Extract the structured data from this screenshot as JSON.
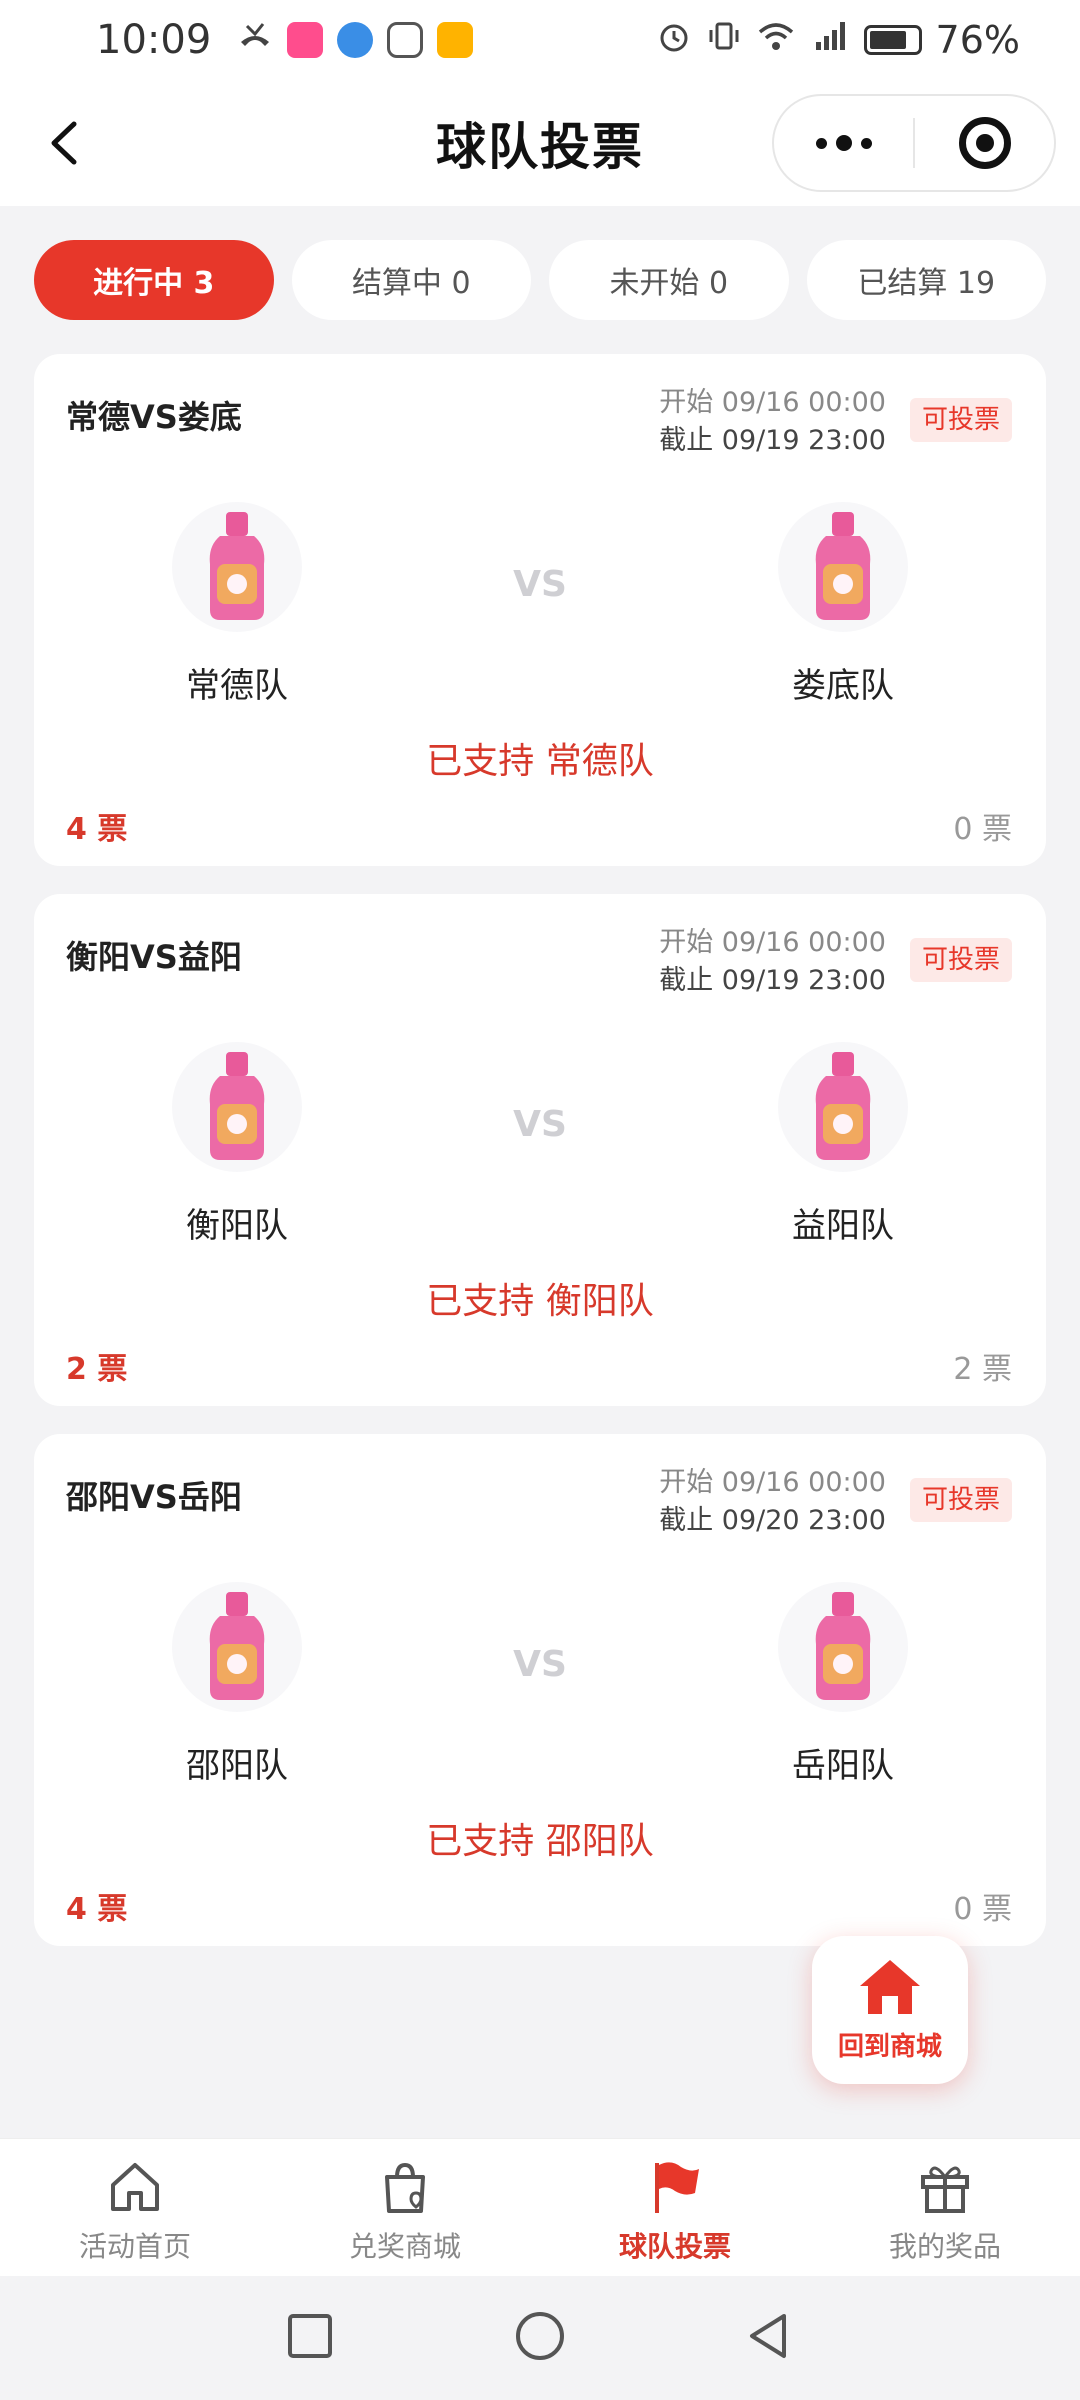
{
  "status_bar": {
    "time": "10:09",
    "battery": "76%"
  },
  "header": {
    "title": "球队投票"
  },
  "tabs": [
    {
      "label": "进行中 3",
      "active": true
    },
    {
      "label": "结算中 0",
      "active": false
    },
    {
      "label": "未开始 0",
      "active": false
    },
    {
      "label": "已结算 19",
      "active": false
    }
  ],
  "matches": [
    {
      "title": "常德VS娄底",
      "start": "开始 09/16 00:00",
      "end": "截止 09/19 23:00",
      "badge": "可投票",
      "team_a": "常德队",
      "team_b": "娄底队",
      "vs": "VS",
      "support": "已支持 常德队",
      "votes_a": "4 票",
      "votes_b": "0 票"
    },
    {
      "title": "衡阳VS益阳",
      "start": "开始 09/16 00:00",
      "end": "截止 09/19 23:00",
      "badge": "可投票",
      "team_a": "衡阳队",
      "team_b": "益阳队",
      "vs": "VS",
      "support": "已支持 衡阳队",
      "votes_a": "2 票",
      "votes_b": "2 票"
    },
    {
      "title": "邵阳VS岳阳",
      "start": "开始 09/16 00:00",
      "end": "截止 09/20 23:00",
      "badge": "可投票",
      "team_a": "邵阳队",
      "team_b": "岳阳队",
      "vs": "VS",
      "support": "已支持 邵阳队",
      "votes_a": "4 票",
      "votes_b": "0 票"
    }
  ],
  "float_button": {
    "label": "回到商城",
    "icon": "home-icon"
  },
  "tabbar": [
    {
      "label": "活动首页",
      "icon": "home-outline-icon",
      "active": false
    },
    {
      "label": "兑奖商城",
      "icon": "shopping-bag-heart-icon",
      "active": false
    },
    {
      "label": "球队投票",
      "icon": "red-flag-icon",
      "active": true
    },
    {
      "label": "我的奖品",
      "icon": "gift-icon",
      "active": false
    }
  ],
  "colors": {
    "accent": "#e7372a",
    "badge_bg": "#fde9e7",
    "bottle": "#e85a9a"
  }
}
